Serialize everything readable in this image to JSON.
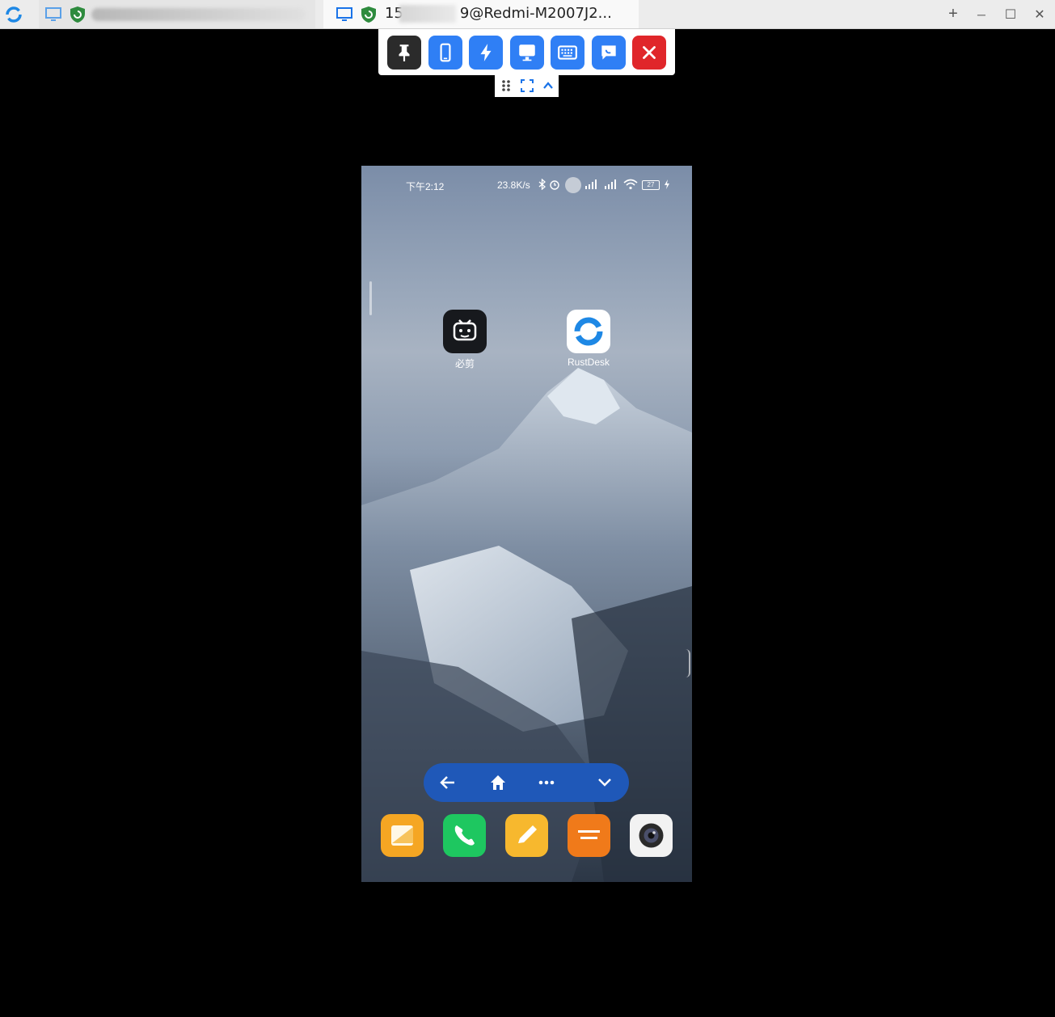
{
  "titlebar": {
    "active_tab_title_prefix": "15",
    "active_tab_title_suffix": "9@Redmi-M2007J2...",
    "new_tab_label": "+",
    "minimize_label": "─",
    "maximize_label": "☐",
    "close_label": "✕"
  },
  "toolbar": {
    "buttons": [
      {
        "name": "pin",
        "color": "#2b2b2b"
      },
      {
        "name": "mobile-actions",
        "color": "#2f7ff5"
      },
      {
        "name": "actions-bolt",
        "color": "#2f7ff5"
      },
      {
        "name": "display",
        "color": "#2f7ff5"
      },
      {
        "name": "keyboard",
        "color": "#2f7ff5"
      },
      {
        "name": "chat",
        "color": "#2f7ff5"
      },
      {
        "name": "close",
        "color": "#e0262a"
      }
    ]
  },
  "phone": {
    "status": {
      "time": "下午2:12",
      "speed": "23.8K/s",
      "battery": "27"
    },
    "apps": [
      {
        "label": "必剪",
        "icon": "bijian-icon"
      },
      {
        "label": "RustDesk",
        "icon": "rustdesk-icon"
      }
    ],
    "dock": [
      {
        "name": "gallery-icon",
        "color": "#f5a623"
      },
      {
        "name": "phone-icon",
        "color": "#1ec760"
      },
      {
        "name": "notes-icon",
        "color": "#f7b82e"
      },
      {
        "name": "file-manager-icon",
        "color": "#f07a1a"
      },
      {
        "name": "camera-icon",
        "color": "#f2f2f2"
      }
    ]
  }
}
